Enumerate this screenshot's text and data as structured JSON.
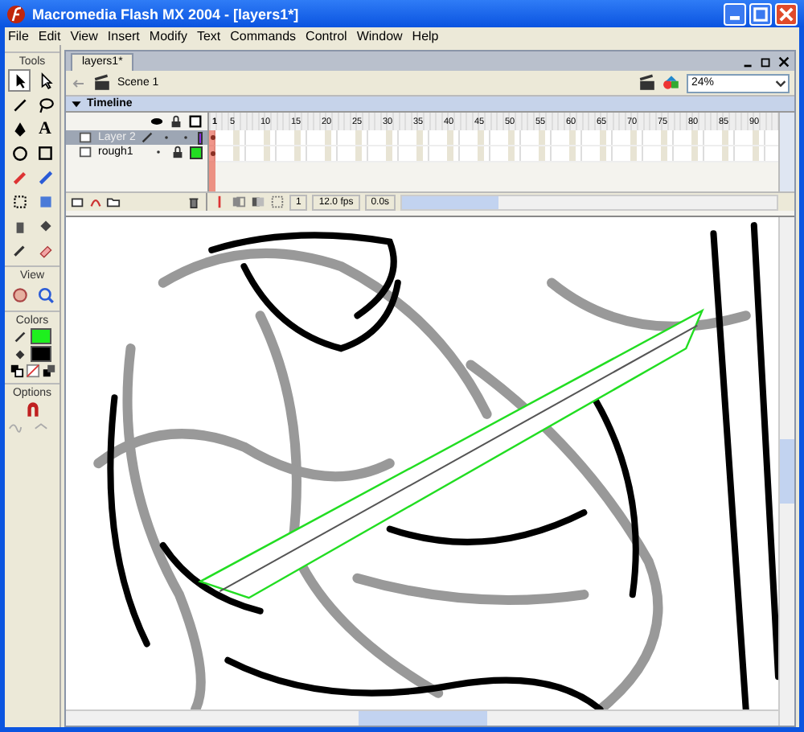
{
  "window": {
    "title": "Macromedia Flash MX 2004 - [layers1*]"
  },
  "menu": [
    "File",
    "Edit",
    "View",
    "Insert",
    "Modify",
    "Text",
    "Commands",
    "Control",
    "Window",
    "Help"
  ],
  "tools_panel": {
    "title": "Tools",
    "text_tool": "A",
    "sections": [
      "View",
      "Colors",
      "Options"
    ]
  },
  "document": {
    "tab": "layers1*",
    "scene": "Scene 1",
    "zoom": "24%"
  },
  "timeline": {
    "title": "Timeline",
    "expanded": true,
    "frame_numbers": [
      "1",
      "5",
      "10",
      "15",
      "20",
      "25",
      "30",
      "35",
      "40",
      "45",
      "50",
      "55",
      "60",
      "65",
      "70",
      "75",
      "80",
      "85",
      "90"
    ],
    "layers": [
      {
        "name": "Layer 2",
        "selected": true,
        "locked": false,
        "color": "#8a2be2"
      },
      {
        "name": "rough1",
        "selected": false,
        "locked": true,
        "color": "#22dd22"
      }
    ],
    "current_frame": "1",
    "frame_rate": "12.0 fps",
    "elapsed": "0.0s"
  }
}
